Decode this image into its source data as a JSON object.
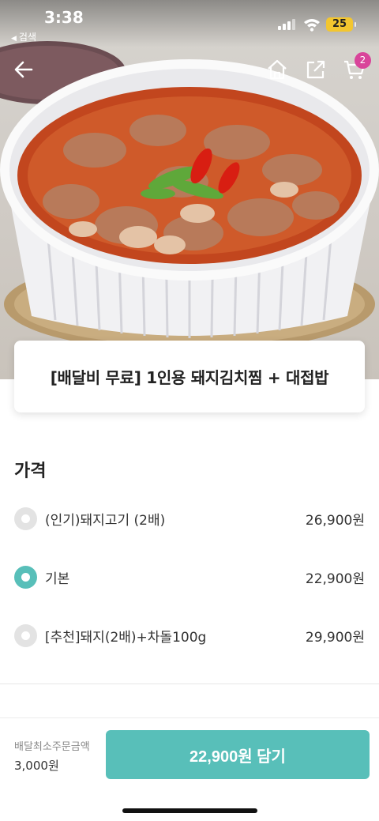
{
  "status_bar": {
    "time": "3:38",
    "back_label": "검색",
    "battery": "25"
  },
  "nav": {
    "cart_count": "2"
  },
  "product": {
    "title": "[배달비 무료] 1인용 돼지김치찜 + 대접밥"
  },
  "price_section": {
    "title": "가격",
    "options": [
      {
        "label": "(인기)돼지고기 (2배)",
        "price": "26,900원",
        "selected": false
      },
      {
        "label": "기본",
        "price": "22,900원",
        "selected": true
      },
      {
        "label": "[추천]돼지(2배)+차돌100g",
        "price": "29,900원",
        "selected": false
      }
    ]
  },
  "bottom_bar": {
    "min_order_label": "배달최소주문금액",
    "min_order_value": "3,000원",
    "add_button": "22,900원 담기"
  },
  "colors": {
    "accent": "#58bfb9",
    "badge": "#d9449a",
    "battery": "#f3c62f"
  }
}
